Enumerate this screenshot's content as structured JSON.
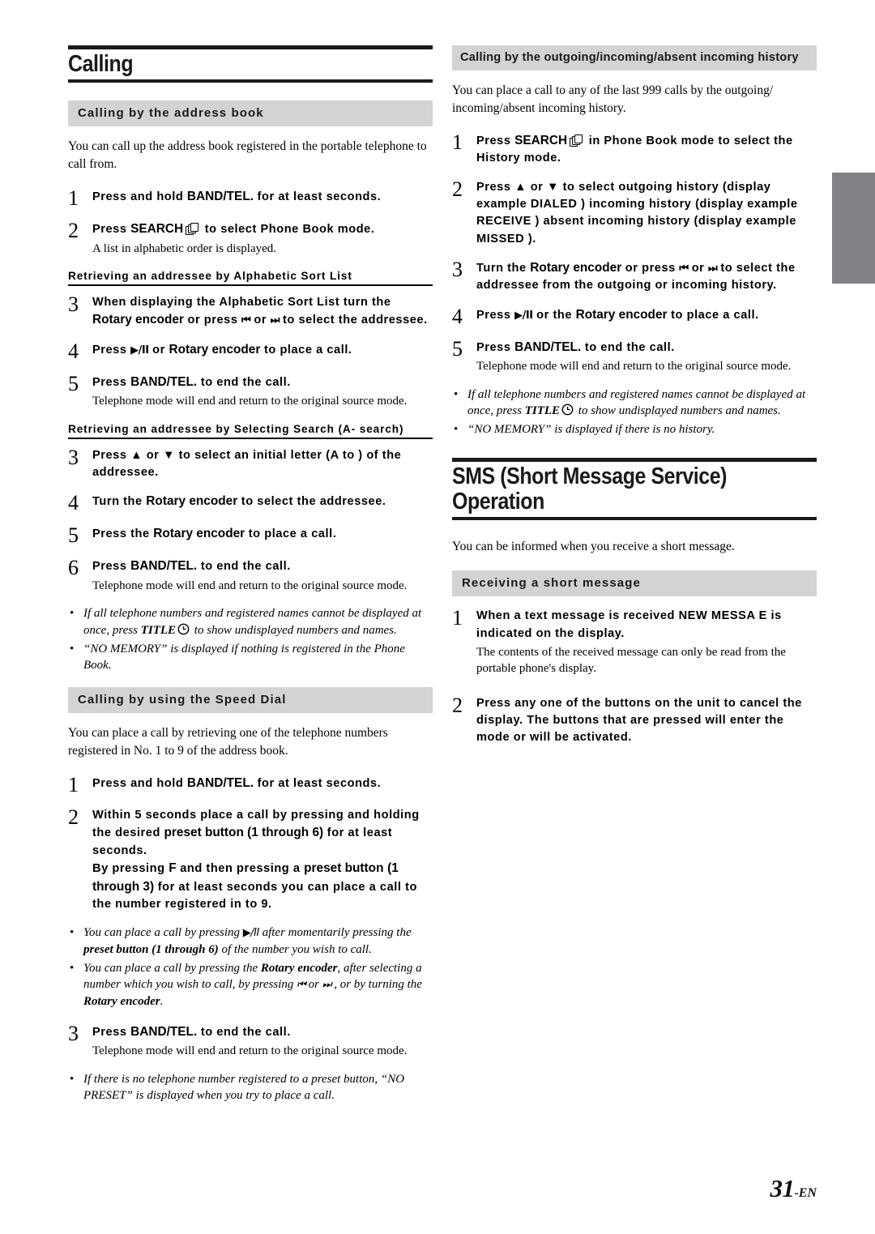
{
  "page": {
    "folio_number": "31",
    "folio_suffix": "-EN"
  },
  "chapter": {
    "title": "Calling"
  },
  "left_column": {
    "section_address_book": {
      "heading": "Calling by the address book",
      "intro": "You can call up the address book registered in the portable telephone to call from.",
      "steps": [
        {
          "number": "1",
          "instruction_pre": "Press and hold ",
          "instruction_bold": "BAND/TEL.",
          "instruction_post": " for at least    seconds."
        },
        {
          "number": "2",
          "instruction_pre": "Press ",
          "instruction_bold": "SEARCH",
          "instruction_post": " to select Phone Book mode.",
          "sub": "A list in alphabetic order is displayed."
        }
      ],
      "subhead_alpha": "Retrieving an addressee by Alphabetic Sort List",
      "alpha_steps": [
        {
          "number": "3",
          "line1_pre": "When displaying the Alphabetic Sort List  turn the ",
          "line1_bold": "Rotary encoder",
          "line1_post": " or press ",
          "line1_tail": " to select the addressee."
        },
        {
          "number": "4",
          "pre": "Press ",
          "mid_bold": "Rotary encoder",
          "post": " to place a call."
        },
        {
          "number": "5",
          "instruction_pre": "Press ",
          "instruction_bold": "BAND/TEL.",
          "instruction_post": " to end the call.",
          "sub": "Telephone mode will end and return to the original source mode."
        }
      ],
      "subhead_select": "Retrieving an addressee by Selecting Search (A-   search)",
      "select_steps": [
        {
          "number": "3",
          "text": "Press ▲ or ▼ to select an initial letter (A  to    ) of the addressee."
        },
        {
          "number": "4",
          "pre": "Turn the ",
          "bold": "Rotary encoder",
          "post": " to select the addressee."
        },
        {
          "number": "5",
          "pre": "Press the ",
          "bold": "Rotary encoder",
          "post": " to place a call."
        },
        {
          "number": "6",
          "instruction_pre": "Press ",
          "instruction_bold": "BAND/TEL.",
          "instruction_post": " to end the call.",
          "sub": "Telephone mode will end and return to the original source mode."
        }
      ],
      "notes": [
        {
          "part1": "If all telephone numbers and registered names cannot be displayed at once, press ",
          "bold": "TITLE",
          "part2": " to show undisplayed numbers and names."
        },
        {
          "part1": "“NO MEMORY” is displayed if nothing is registered in the Phone Book.",
          "bold": "",
          "part2": ""
        }
      ]
    },
    "section_speed_dial": {
      "heading": "Calling by using the Speed Dial",
      "intro": "You can place a call by retrieving one of the telephone numbers registered in No. 1 to 9 of the address book.",
      "steps": [
        {
          "number": "1",
          "instruction_pre": "Press and hold ",
          "instruction_bold": "BAND/TEL.",
          "instruction_post": " for at least    seconds."
        },
        {
          "number": "2",
          "l1": "Within 5 seconds  place a call by pressing and",
          "l2_pre": "holding the desired ",
          "l2_bold": "preset button (1 through 6)",
          "l3": "for at least    seconds.",
          "l4_pre": "By pressing ",
          "l4_boldF": "F",
          "l4_mid": " and then pressing a ",
          "l4_bold2": "preset button",
          "l5_bold": "(1 through 3)",
          "l5_post": " for at least    seconds  you can",
          "l6": "place a call to the number registered in     to 9."
        }
      ],
      "notes": [
        {
          "pre": "You can place a call by pressing ",
          "post_pre": " after momentarily pressing the ",
          "bold": "preset button (1 through 6)",
          "post": " of the number you wish to call."
        },
        {
          "pre": "You can place a call by pressing the ",
          "bold": "Rotary encoder",
          "mid": ", after selecting a number which you wish to call, by pressing ",
          "tail_pre": " or ",
          "tail": " , or by turning the ",
          "bold2": "Rotary encoder",
          "end": "."
        }
      ],
      "final_step": {
        "number": "3",
        "instruction_pre": "Press ",
        "instruction_bold": "BAND/TEL.",
        "instruction_post": " to end the call.",
        "sub": "Telephone mode will end and return to the original source mode."
      },
      "final_note": "If there is no telephone number registered to a preset button, “NO PRESET” is displayed when you try to place a call."
    }
  },
  "right_column": {
    "section_history": {
      "heading": "Calling by the outgoing/incoming/absent incoming history",
      "intro": "You can place a call to any of the last 999 calls by the outgoing/ incoming/absent incoming history.",
      "steps": [
        {
          "number": "1",
          "pre": "Press ",
          "bold": "SEARCH",
          "post": " in Phone Book mode to select the History mode."
        },
        {
          "number": "2",
          "text": "Press ▲ or ▼ to select outgoing history (display example   DIALED  ) incoming history (display example   RECEIVE  ) absent incoming history (display example    MISSED  )."
        },
        {
          "number": "3",
          "pre": "Turn the ",
          "bold": "Rotary encoder",
          "mid": " or press ",
          "post": " to select the addressee from the outgoing or incoming history."
        },
        {
          "number": "4",
          "pre": "Press ",
          "mid": " or the ",
          "bold": "Rotary encoder",
          "post": " to place a call."
        },
        {
          "number": "5",
          "pre": "Press ",
          "bold": "BAND/TEL.",
          "post": " to end the call.",
          "sub": "Telephone mode will end and return to the original source mode."
        }
      ],
      "notes": [
        {
          "part1": "If all telephone numbers and registered names cannot be displayed at once, press ",
          "bold": "TITLE",
          "part2": " to show undisplayed numbers and names."
        },
        {
          "part1": "“NO MEMORY” is displayed if there is no history.",
          "bold": "",
          "part2": ""
        }
      ]
    },
    "section_sms": {
      "title": "SMS (Short Message Service) Operation",
      "intro": "You can be informed when you receive a short message.",
      "heading": "Receiving a short message",
      "steps": [
        {
          "number": "1",
          "text": "When a text message is received   NEW MESSA  E   is indicated on the display.",
          "sub": "The contents of the received message can only be read from the portable phone's display."
        },
        {
          "number": "2",
          "text": "Press any one of the buttons on the unit to cancel the display. The buttons that are pressed will enter the mode or will be activated."
        }
      ]
    }
  },
  "icons": {
    "search": "search-stacked-pages-icon",
    "title_clock": "clock-icon",
    "prev_track": "⏮",
    "next_track": "⏭",
    "play_pause": "▶/II",
    "up": "▲",
    "down": "▼"
  },
  "colors": {
    "section_bar": "#d2d3d4",
    "rule": "#1a1a1a",
    "edge_tab": "#808285"
  }
}
